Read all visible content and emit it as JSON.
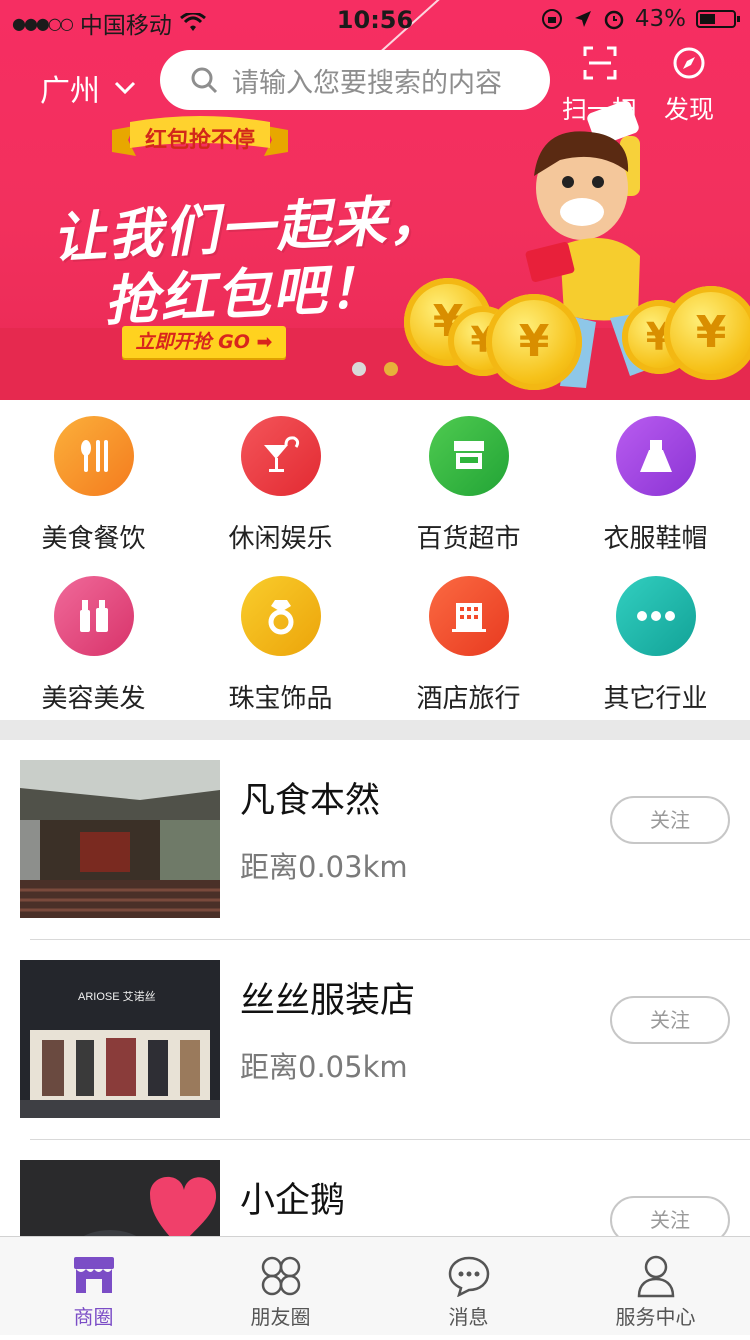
{
  "status_bar": {
    "carrier": "中国移动",
    "time": "10:56",
    "battery": "43%"
  },
  "header": {
    "city": "广州",
    "search_placeholder": "请输入您要搜索的内容",
    "scan_label": "扫一扫",
    "discover_label": "发现"
  },
  "banner": {
    "ribbon": "红包抢不停",
    "slogan_line1": "让我们一起来，",
    "slogan_line2": "抢红包吧！",
    "cta": "立即开抢 GO ➡",
    "coin_symbol": "¥",
    "page_count": 2,
    "active_page": 2
  },
  "categories": [
    {
      "label": "美食餐饮",
      "icon": "utensils-icon",
      "color": "#f7931e"
    },
    {
      "label": "休闲娱乐",
      "icon": "cocktail-icon",
      "color": "#ee3a3f"
    },
    {
      "label": "百货超市",
      "icon": "store-icon",
      "color": "#2fb53c"
    },
    {
      "label": "衣服鞋帽",
      "icon": "dress-icon",
      "color": "#a646e0"
    },
    {
      "label": "美容美发",
      "icon": "cosmetics-icon",
      "color": "#e9497e"
    },
    {
      "label": "珠宝饰品",
      "icon": "ring-icon",
      "color": "#f2b90f"
    },
    {
      "label": "酒店旅行",
      "icon": "hotel-icon",
      "color": "#f34b2c"
    },
    {
      "label": "其它行业",
      "icon": "more-icon",
      "color": "#1cb7a9"
    }
  ],
  "shops": [
    {
      "name": "凡食本然",
      "distance": "距离0.03km",
      "follow": "关注"
    },
    {
      "name": "丝丝服装店",
      "distance": "距离0.05km",
      "follow": "关注",
      "sign_text": "ARIOSE 艾诺丝"
    },
    {
      "name": "小企鹅",
      "distance": "",
      "follow": "关注"
    }
  ],
  "tabbar": {
    "items": [
      {
        "label": "商圈",
        "icon": "shop-icon"
      },
      {
        "label": "朋友圈",
        "icon": "clover-icon"
      },
      {
        "label": "消息",
        "icon": "chat-bubble-icon"
      },
      {
        "label": "服务中心",
        "icon": "user-icon"
      }
    ],
    "active_index": 0,
    "active_color": "#7b4dc6"
  }
}
